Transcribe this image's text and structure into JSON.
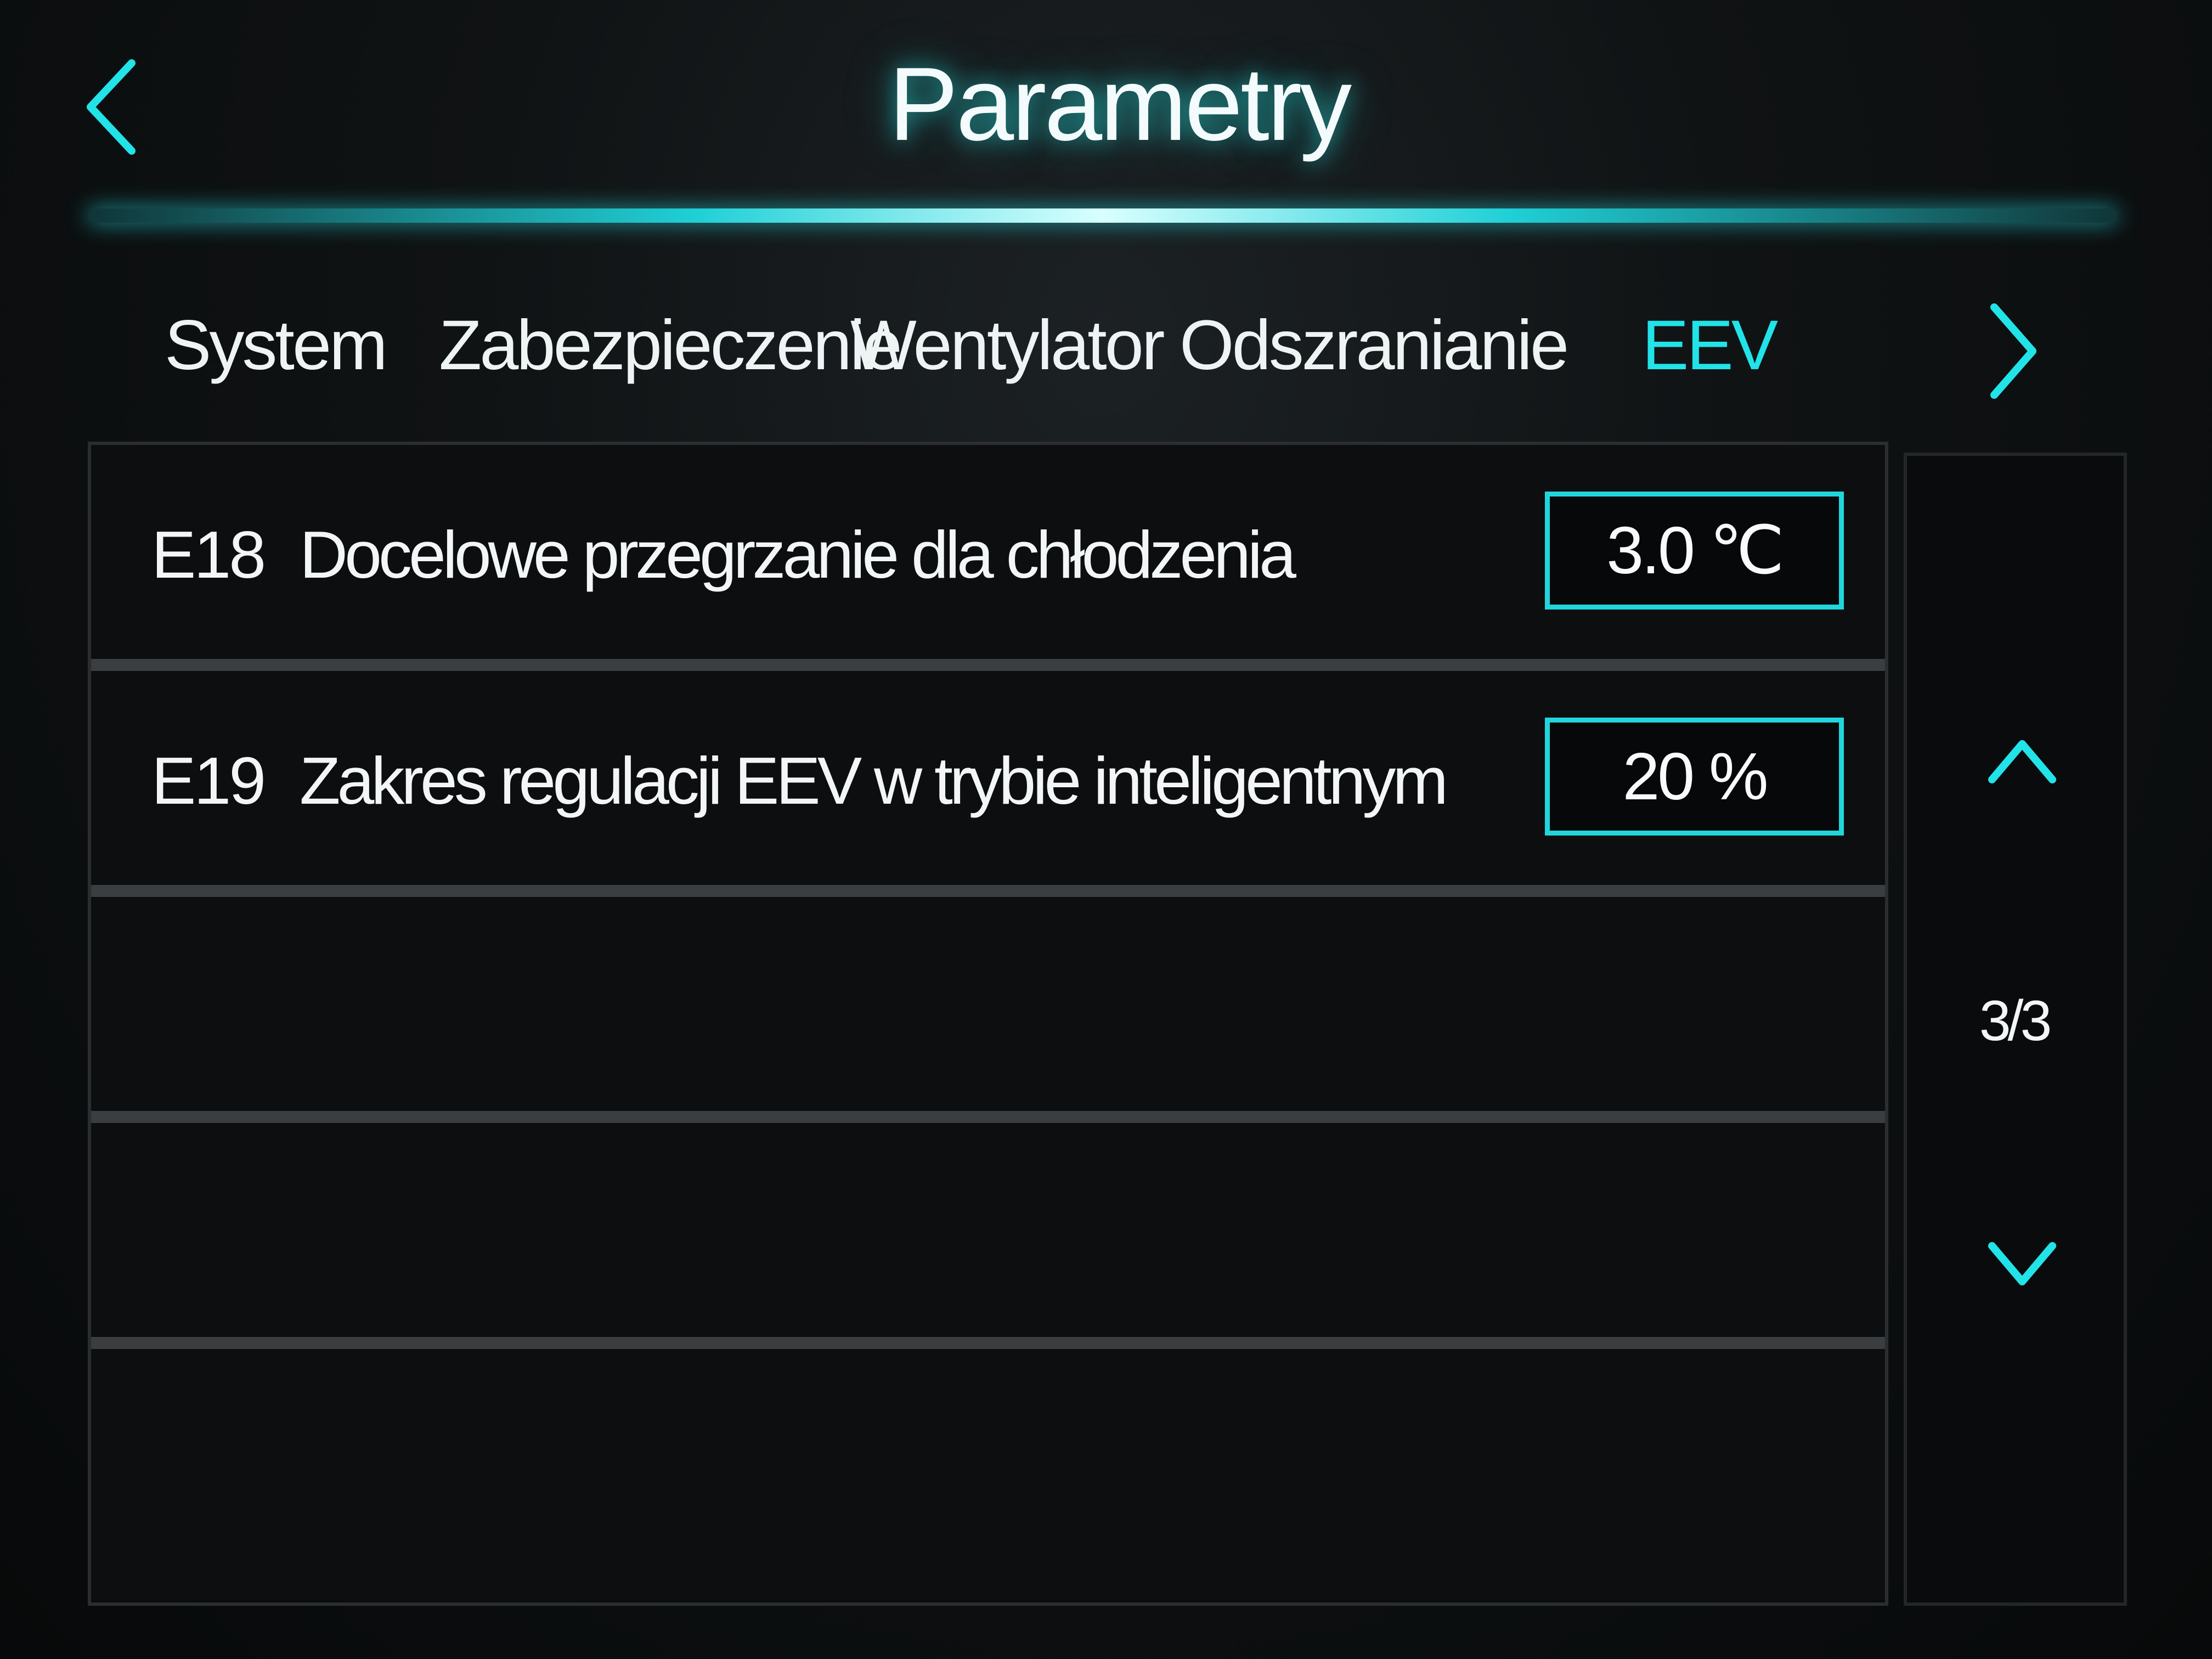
{
  "header": {
    "title": "Parametry",
    "back_icon": "chevron-left-icon"
  },
  "tabs": {
    "items": [
      {
        "label": "System",
        "active": false
      },
      {
        "label": "Zabezpieczenie",
        "active": false
      },
      {
        "label": "Wentylator",
        "active": false
      },
      {
        "label": "Odszranianie",
        "active": false
      },
      {
        "label": "EEV",
        "active": true
      }
    ],
    "next_icon": "chevron-right-icon"
  },
  "parameters": [
    {
      "code": "E18",
      "label": "Docelowe przegrzanie dla chłodzenia",
      "value": "3.0 ℃"
    },
    {
      "code": "E19",
      "label": "Zakres regulacji EEV w trybie inteligentnym",
      "value": "20 %"
    }
  ],
  "pagination": {
    "indicator": "3/3",
    "up_icon": "chevron-up-icon",
    "down_icon": "chevron-down-icon"
  },
  "colors": {
    "accent": "#21e3e8",
    "text": "#f2f6f7",
    "background": "#0d0e0f",
    "divider": "#3b3e40"
  }
}
